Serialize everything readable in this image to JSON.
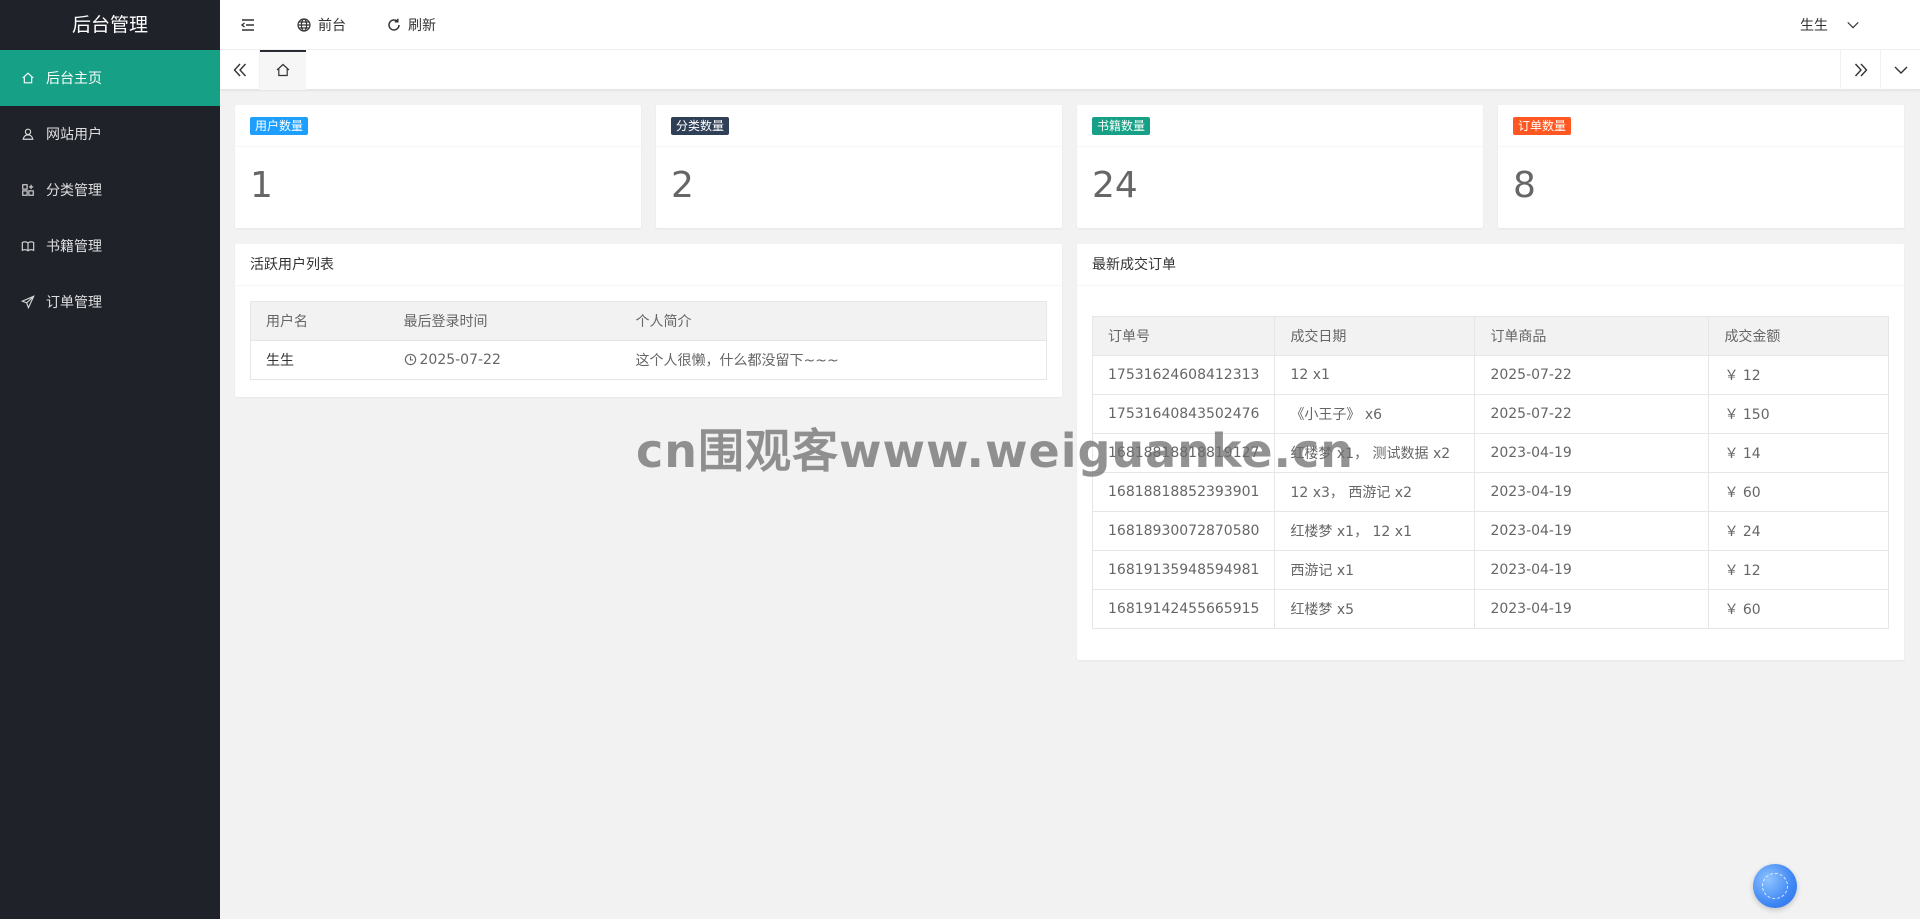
{
  "app": {
    "title": "后台管理"
  },
  "sidebar": {
    "items": [
      {
        "label": "后台主页",
        "icon": "home-icon",
        "active": true
      },
      {
        "label": "网站用户",
        "icon": "user-icon",
        "active": false
      },
      {
        "label": "分类管理",
        "icon": "category-icon",
        "active": false
      },
      {
        "label": "书籍管理",
        "icon": "book-icon",
        "active": false
      },
      {
        "label": "订单管理",
        "icon": "send-icon",
        "active": false
      }
    ]
  },
  "header": {
    "menu_toggle_icon": "menu-fold-icon",
    "frontend_label": "前台",
    "refresh_label": "刷新",
    "user_name": "生生"
  },
  "stats": [
    {
      "label": "用户数量",
      "value": "1",
      "color": "#1e9fff"
    },
    {
      "label": "分类数量",
      "value": "2",
      "color": "#2f4056"
    },
    {
      "label": "书籍数量",
      "value": "24",
      "color": "#16a085"
    },
    {
      "label": "订单数量",
      "value": "8",
      "color": "#ff5722"
    }
  ],
  "active_users": {
    "title": "活跃用户列表",
    "columns": [
      "用户名",
      "最后登录时间",
      "个人简介"
    ],
    "rows": [
      {
        "name": "生生",
        "last_login": "2025-07-22",
        "bio": "这个人很懒，什么都没留下~~~"
      }
    ]
  },
  "recent_orders": {
    "title": "最新成交订单",
    "columns": [
      "订单号",
      "成交日期",
      "订单商品",
      "成交金额"
    ],
    "rows": [
      {
        "order_no": "17531624608412313",
        "goods": "12 x1",
        "date": "2025-07-22",
        "amount": "￥ 12"
      },
      {
        "order_no": "17531640843502476",
        "goods": "《小王子》 x6",
        "date": "2025-07-22",
        "amount": "￥ 150"
      },
      {
        "order_no": "16818818818819127",
        "goods": "红楼梦 x1， 测试数据 x2",
        "date": "2023-04-19",
        "amount": "￥ 14"
      },
      {
        "order_no": "16818818852393901",
        "goods": "12 x3， 西游记 x2",
        "date": "2023-04-19",
        "amount": "￥ 60"
      },
      {
        "order_no": "16818930072870580",
        "goods": "红楼梦 x1， 12 x1",
        "date": "2023-04-19",
        "amount": "￥ 24"
      },
      {
        "order_no": "16819135948594981",
        "goods": "西游记 x1",
        "date": "2023-04-19",
        "amount": "￥ 12"
      },
      {
        "order_no": "16819142455665915",
        "goods": "红楼梦 x5",
        "date": "2023-04-19",
        "amount": "￥ 60"
      }
    ]
  },
  "watermark": "cn围观客www.weiguanke.cn"
}
